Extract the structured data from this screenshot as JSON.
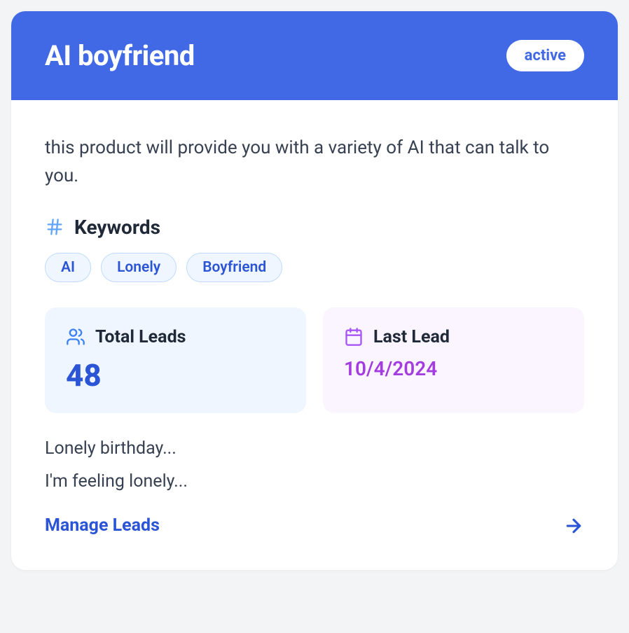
{
  "card": {
    "title": "AI boyfriend",
    "status": "active",
    "description": "this product will provide you with a variety of AI that can talk to you.",
    "keywords_label": "Keywords",
    "keywords": [
      "AI",
      "Lonely",
      "Boyfriend"
    ],
    "stats": {
      "total_leads": {
        "label": "Total Leads",
        "value": "48"
      },
      "last_lead": {
        "label": "Last Lead",
        "value": "10/4/2024"
      }
    },
    "lead_samples": [
      "Lonely birthday...",
      "I'm feeling lonely..."
    ],
    "manage_label": "Manage Leads"
  }
}
